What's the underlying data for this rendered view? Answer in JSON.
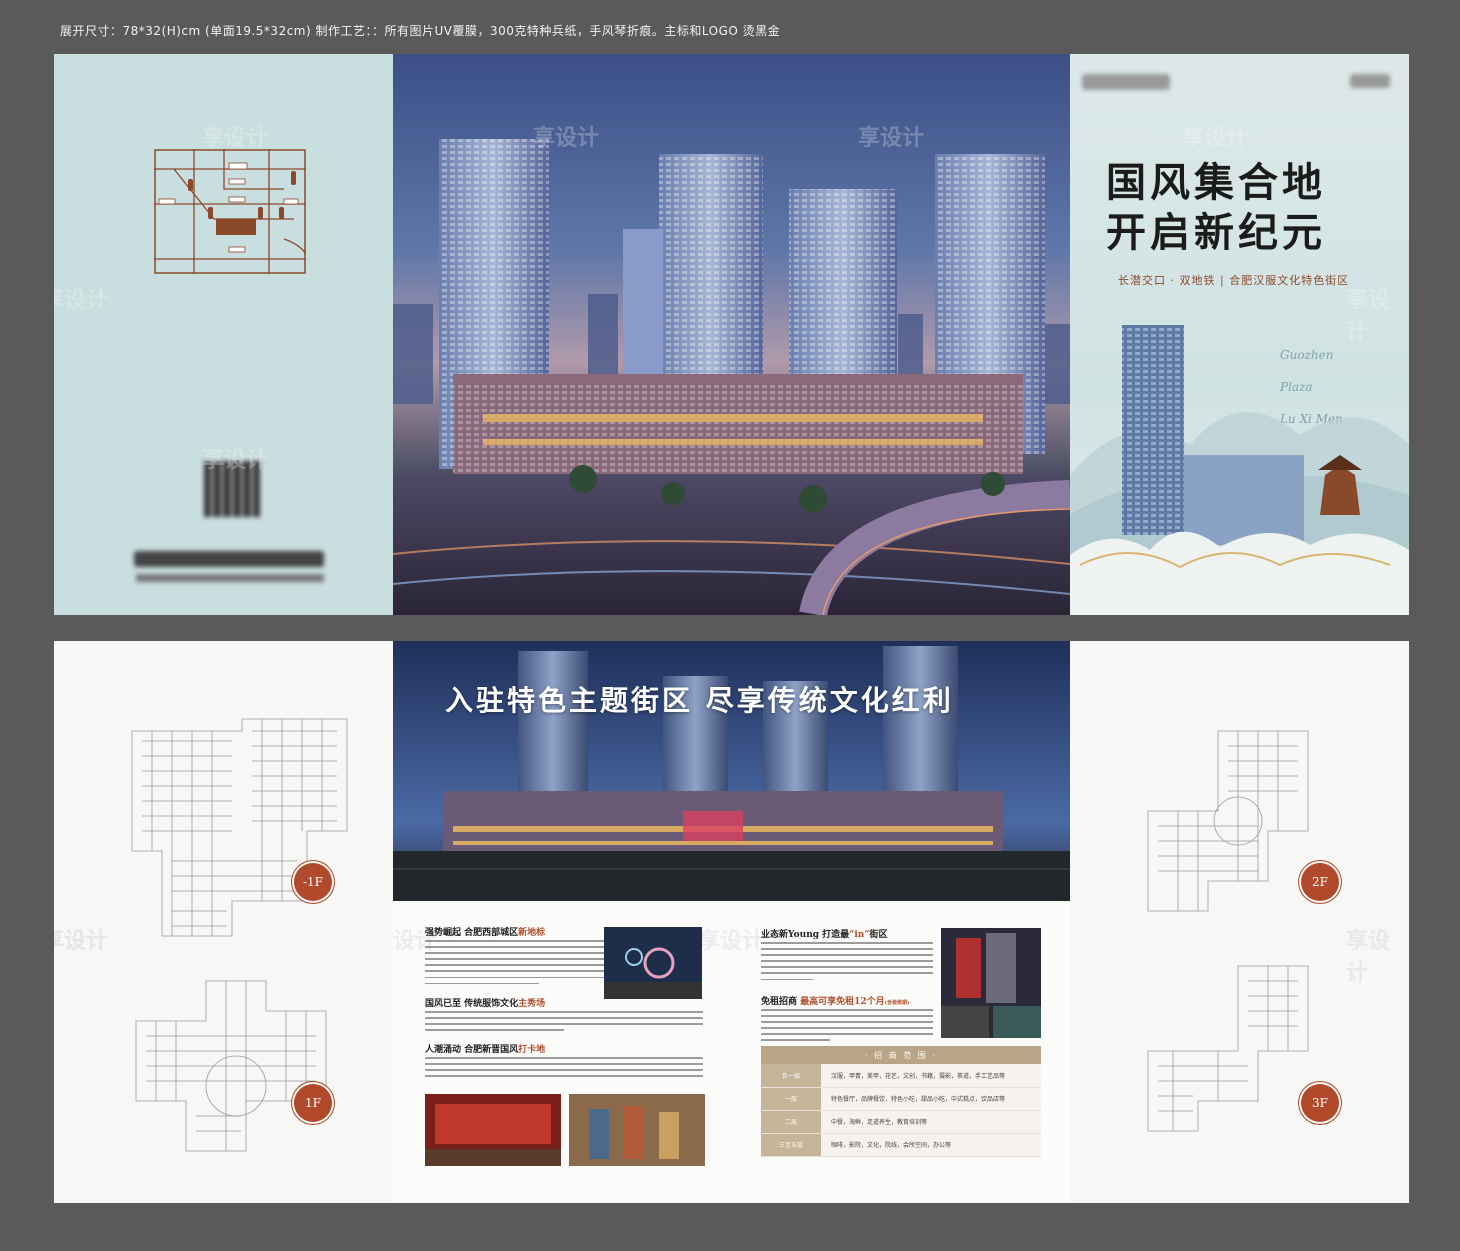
{
  "spec": {
    "text": "展开尺寸：78*32(H)cm  (单面19.5*32cm)   制作工艺：：所有图片UV覆膜，300克特种兵纸，手风琴折痕。主标和LOGO 烫黑金"
  },
  "watermark": "享设计",
  "back_panel": {
    "map_labels": [
      "",
      ""
    ],
    "qr_label": "",
    "phone_blurred": ""
  },
  "cover": {
    "title_line1": "国风集合地",
    "title_line2": "开启新纪元",
    "subtitle": "长潜交口 · 双地铁 | 合肥汉服文化特色街区",
    "en_line1": "Guozhen",
    "en_line2": "Plaza",
    "en_line3": "Lu Xi Men"
  },
  "center": {
    "headline": "入驻特色主题街区  尽享传统文化红利",
    "sec1_title": "强势崛起  合肥西部城区",
    "sec1_hl": "新地标",
    "sec2_title": "国风已至 传统服饰文化",
    "sec2_hl": "主秀场",
    "sec3_title": "人潮涌动  合肥新晋国风",
    "sec3_hl": "打卡地",
    "sec4_title": "业态新Young 打造最",
    "sec4_hl": "“in”",
    "sec4_tail": "街区",
    "sec5_title": "免租招商  ",
    "sec5_hl": "最高可享免租12个月",
    "sec5_note": "(含装修期)",
    "table_header": "· 招 商 范 围 ·",
    "table_rows": [
      {
        "floor": "负一层",
        "desc": "汉服，甲胄，美甲，花艺，文创，书籍，摄影，茶道，手工艺品等"
      },
      {
        "floor": "一层",
        "desc": "特色餐厅，品牌餐饮，特色小吃，甜品小吃，中式糕点，饮品店等"
      },
      {
        "floor": "二层",
        "desc": "中餐，海鲜，足道养生，教育培训等"
      },
      {
        "floor": "三至五层",
        "desc": "咖啡，影院，文化，院线，会所空间，办公等"
      }
    ]
  },
  "floor_badges": {
    "b1": "-1F",
    "f1": "1F",
    "f2": "2F",
    "f3": "3F"
  },
  "colors": {
    "background": "#5a5a5a",
    "accent": "#b04a2a",
    "table_header": "#b9a586",
    "cover_bg": "#cfe2e2"
  }
}
